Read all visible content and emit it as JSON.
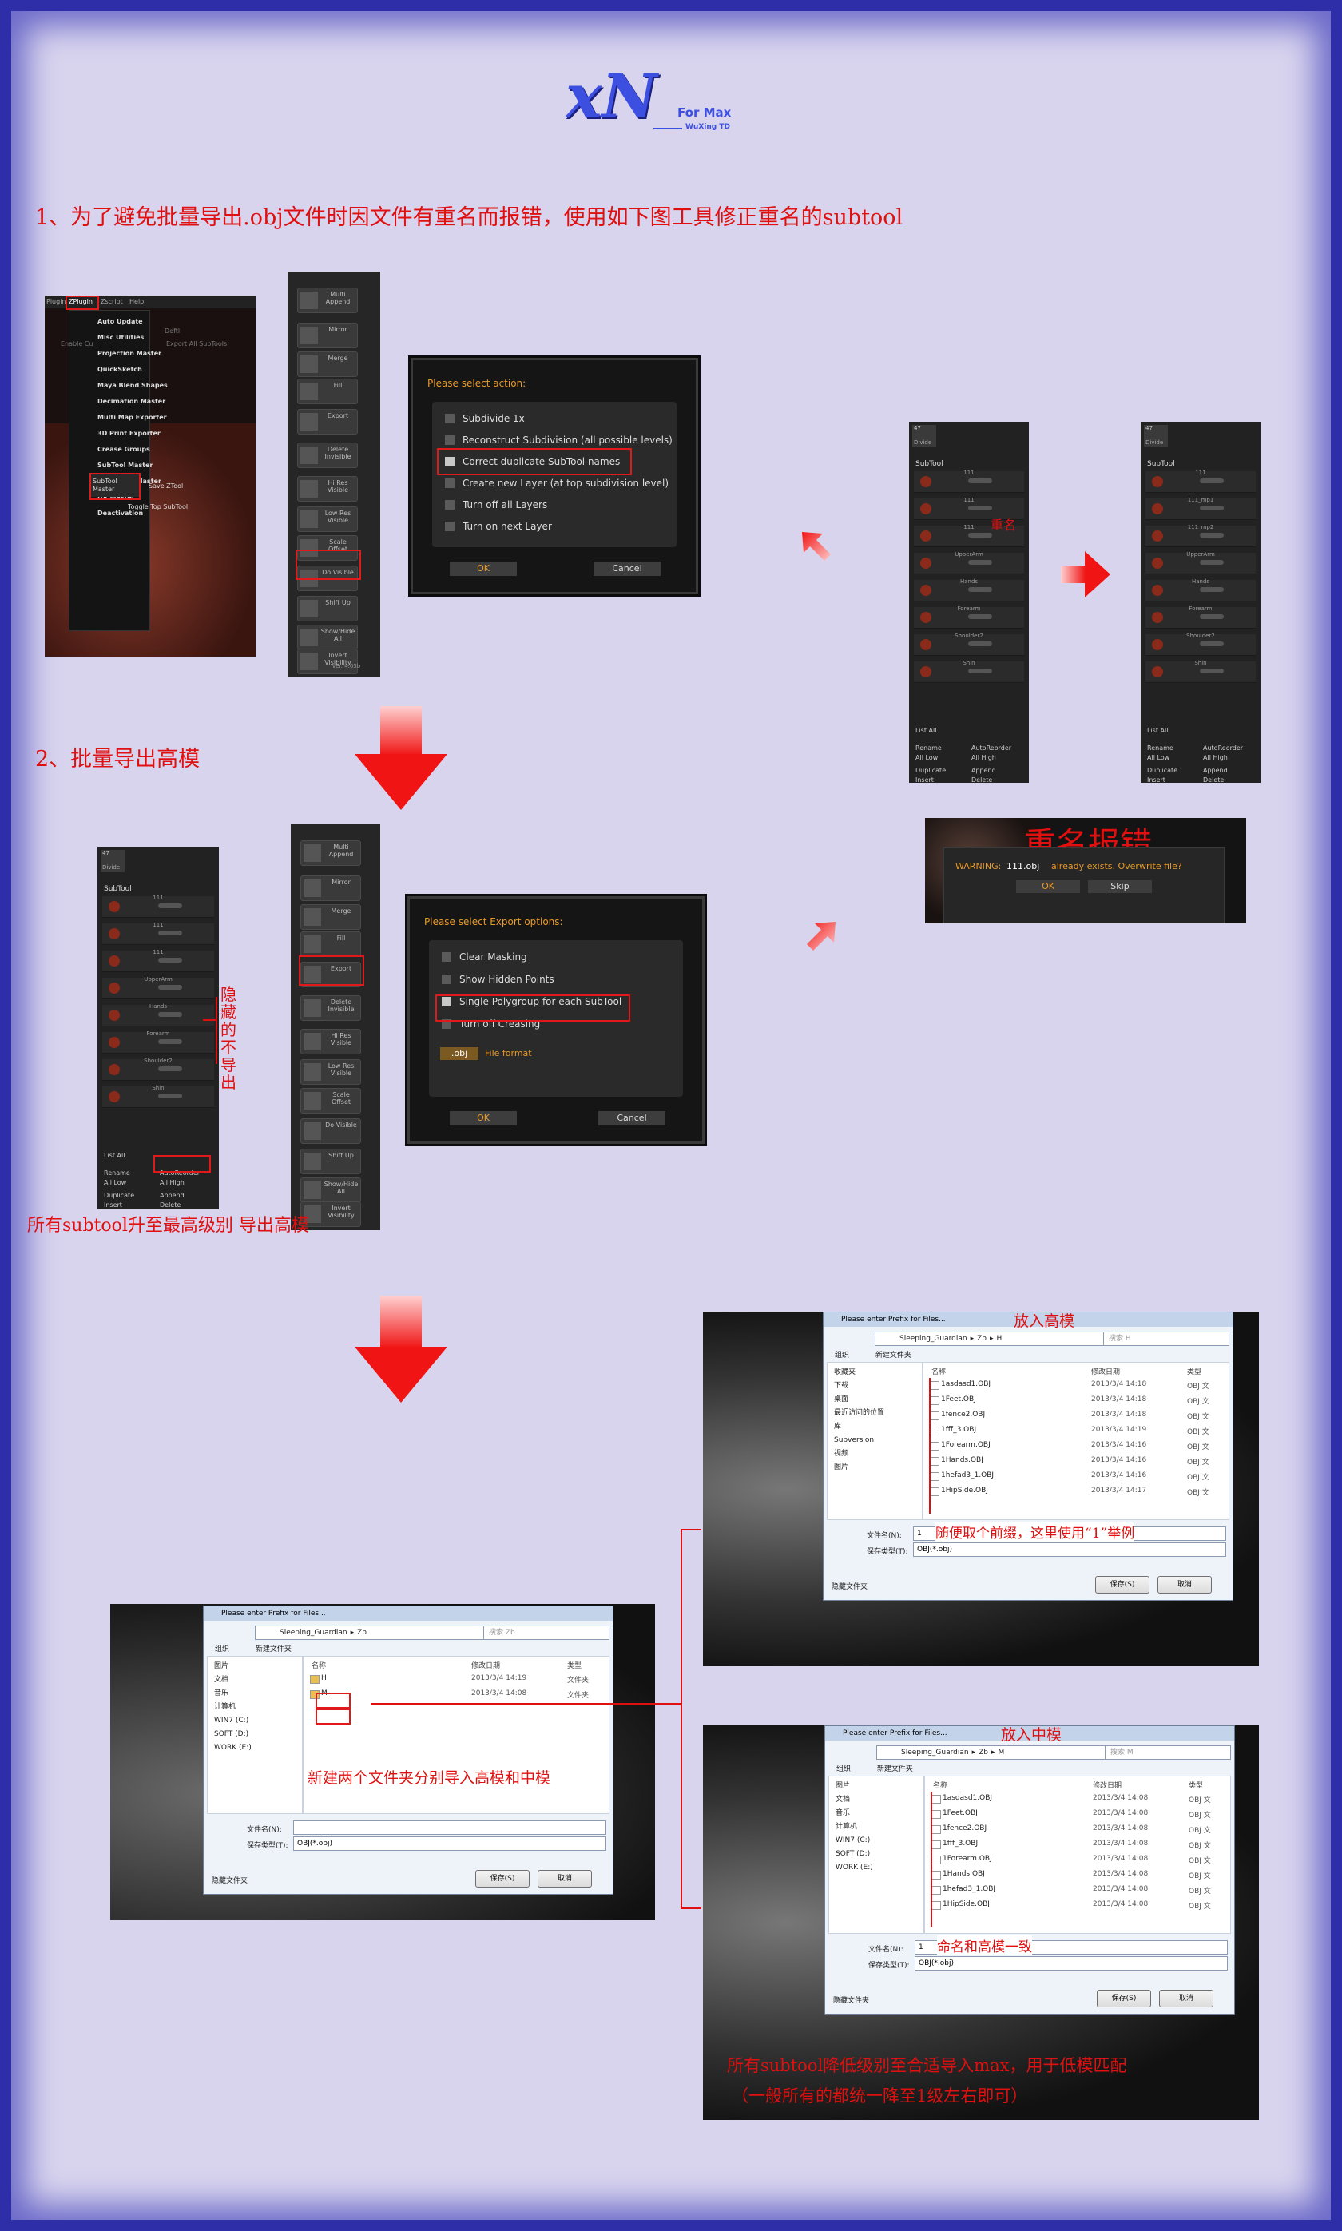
{
  "logo": {
    "main": "xN",
    "sub": "For Max",
    "author": "WuXing TD"
  },
  "section1": {
    "heading": "1、为了避免批量导出.obj文件时因文件有重名而报错，使用如下图工具修正重名的subtool"
  },
  "section2": {
    "heading": "2、批量导出高模",
    "note_upgrade": "所有subtool升至最高级别 导出高模"
  },
  "zplugin_menu": {
    "top_tabs": [
      "Plugin",
      "ZPlugin",
      "Zscript",
      "Help"
    ],
    "items": [
      "Auto Update",
      "Misc Utilities",
      "Projection Master",
      "QuickSketch",
      "Maya Blend Shapes",
      "Decimation Master",
      "Multi Map Exporter",
      "3D Print Exporter",
      "Crease Groups",
      "SubTool Master",
      "Transpose Master",
      "UV Master",
      "Deactivation"
    ],
    "side_labels": [
      "Deftl",
      "Export All SubTools",
      "Enable Cu"
    ],
    "subtool_master_btn": "SubTool Master",
    "save_ztool": "Save ZTool",
    "toggle_top": "Toggle Top SubTool"
  },
  "stm_panel": {
    "buttons": [
      "Multi Append",
      "Mirror",
      "Merge",
      "Fill",
      "Export",
      "Delete Invisible",
      "Hi Res Visible",
      "Low Res Visible",
      "Scale Offset",
      "Do Visible",
      "Shift Up",
      "Show/Hide All",
      "Invert Visibility"
    ],
    "footer": "ver. 4.03b"
  },
  "action_dialog": {
    "title": "Please select action:",
    "options": [
      {
        "label": "Subdivide 1x",
        "checked": false
      },
      {
        "label": "Reconstruct Subdivision (all possible levels)",
        "checked": false
      },
      {
        "label": "Correct duplicate SubTool names",
        "checked": true
      },
      {
        "label": "Create new Layer (at top subdivision level)",
        "checked": false
      },
      {
        "label": "Turn off all Layers",
        "checked": false
      },
      {
        "label": "Turn on next Layer",
        "checked": false
      }
    ],
    "ok": "OK",
    "cancel": "Cancel"
  },
  "export_dialog": {
    "title": "Please select Export options:",
    "options": [
      {
        "label": "Clear Masking",
        "checked": false
      },
      {
        "label": "Show Hidden Points",
        "checked": false
      },
      {
        "label": "Single Polygroup for each SubTool",
        "checked": true
      },
      {
        "label": "Turn off Creasing",
        "checked": false
      }
    ],
    "format": ".obj",
    "format_label": "File format",
    "ok": "OK",
    "cancel": "Cancel"
  },
  "subtool_panel": {
    "header": "SubTool",
    "layer_labels": [
      "111",
      "111",
      "111",
      "UpperArm",
      "Hands",
      "Forearm",
      "Shoulder2",
      "Shin"
    ],
    "layer_labels_fixed": [
      "111",
      "111_mp1",
      "111_mp2",
      "UpperArm",
      "Hands",
      "Forearm",
      "Shoulder2",
      "Shin"
    ],
    "list_all": "List All",
    "rename": "Rename",
    "autoreorder": "AutoReorder",
    "all_low": "All Low",
    "all_high": "All High",
    "duplicate": "Duplicate",
    "append": "Append",
    "insert": "Insert",
    "delete": "Delete",
    "top_label": "47",
    "top_sub": "Divide"
  },
  "dup_note": "重名",
  "hidden_note": "隐藏的不导出",
  "error_box": {
    "heading": "重名报错",
    "warning": "WARNING:",
    "file": "111.obj",
    "message": "already exists. Overwrite file?",
    "ok": "OK",
    "skip": "Skip"
  },
  "main_dialog": {
    "title": "Please enter Prefix for Files...",
    "path": [
      "Sleeping_Guardian",
      "Zb"
    ],
    "search": "搜索 Zb",
    "toolbar": [
      "组织",
      "新建文件夹"
    ],
    "nav": [
      "图片",
      "文档",
      "音乐",
      "计算机",
      "WIN7 (C:)",
      "SOFT (D:)",
      "WORK (E:)"
    ],
    "col_name": "名称",
    "col_date": "修改日期",
    "col_type": "类型",
    "files": [
      {
        "name": "H",
        "date": "2013/3/4 14:19",
        "type": "文件夹"
      },
      {
        "name": "M",
        "date": "2013/3/4 14:08",
        "type": "文件夹"
      }
    ],
    "filename_label": "文件名(N):",
    "filetype_label": "保存类型(T):",
    "filetype": "OBJ(*.obj)",
    "save": "保存(S)",
    "cancel": "取消",
    "hide": "隐藏文件夹",
    "note": "新建两个文件夹分别导入高模和中模"
  },
  "dialog_h": {
    "title": "Please enter Prefix for Files...",
    "path": [
      "Sleeping_Guardian",
      "Zb",
      "H"
    ],
    "search": "搜索 H",
    "toolbar": [
      "组织",
      "新建文件夹"
    ],
    "nav": [
      "收藏夹",
      "下载",
      "桌面",
      "最近访问的位置",
      "库",
      "Subversion",
      "视频",
      "图片"
    ],
    "files": [
      {
        "name": "1asdasd1.OBJ",
        "date": "2013/3/4 14:18",
        "type": "OBJ 文"
      },
      {
        "name": "1Feet.OBJ",
        "date": "2013/3/4 14:18",
        "type": "OBJ 文"
      },
      {
        "name": "1fence2.OBJ",
        "date": "2013/3/4 14:18",
        "type": "OBJ 文"
      },
      {
        "name": "1fff_3.OBJ",
        "date": "2013/3/4 14:19",
        "type": "OBJ 文"
      },
      {
        "name": "1Forearm.OBJ",
        "date": "2013/3/4 14:16",
        "type": "OBJ 文"
      },
      {
        "name": "1Hands.OBJ",
        "date": "2013/3/4 14:16",
        "type": "OBJ 文"
      },
      {
        "name": "1hefad3_1.OBJ",
        "date": "2013/3/4 14:16",
        "type": "OBJ 文"
      },
      {
        "name": "1HipSide.OBJ",
        "date": "2013/3/4 14:17",
        "type": "OBJ 文"
      }
    ],
    "filename": "1",
    "filetype": "OBJ(*.obj)",
    "heading": "放入高模",
    "note": "随便取个前缀，这里使用“1”举例",
    "save": "保存(S)",
    "cancel": "取消",
    "hide": "隐藏文件夹",
    "filename_label": "文件名(N):",
    "filetype_label": "保存类型(T):",
    "col_name": "名称",
    "col_date": "修改日期",
    "col_type": "类型"
  },
  "dialog_m": {
    "title": "Please enter Prefix for Files...",
    "path": [
      "Sleeping_Guardian",
      "Zb",
      "M"
    ],
    "search": "搜索 M",
    "toolbar": [
      "组织",
      "新建文件夹"
    ],
    "nav": [
      "图片",
      "文档",
      "音乐",
      "计算机",
      "WIN7 (C:)",
      "SOFT (D:)",
      "WORK (E:)"
    ],
    "files": [
      {
        "name": "1asdasd1.OBJ",
        "date": "2013/3/4 14:08",
        "type": "OBJ 文"
      },
      {
        "name": "1Feet.OBJ",
        "date": "2013/3/4 14:08",
        "type": "OBJ 文"
      },
      {
        "name": "1fence2.OBJ",
        "date": "2013/3/4 14:08",
        "type": "OBJ 文"
      },
      {
        "name": "1fff_3.OBJ",
        "date": "2013/3/4 14:08",
        "type": "OBJ 文"
      },
      {
        "name": "1Forearm.OBJ",
        "date": "2013/3/4 14:08",
        "type": "OBJ 文"
      },
      {
        "name": "1Hands.OBJ",
        "date": "2013/3/4 14:08",
        "type": "OBJ 文"
      },
      {
        "name": "1hefad3_1.OBJ",
        "date": "2013/3/4 14:08",
        "type": "OBJ 文"
      },
      {
        "name": "1HipSide.OBJ",
        "date": "2013/3/4 14:08",
        "type": "OBJ 文"
      }
    ],
    "filename": "1",
    "filetype": "OBJ(*.obj)",
    "heading": "放入中模",
    "note": "命名和高模一致",
    "save": "保存(S)",
    "cancel": "取消",
    "hide": "隐藏文件夹",
    "filename_label": "文件名(N):",
    "filetype_label": "保存类型(T):",
    "col_name": "名称",
    "col_date": "修改日期",
    "col_type": "类型"
  },
  "bottom_note": {
    "line1": "所有subtool降低级别至合适导入max，用于低模匹配",
    "line2": "（一般所有的都统一降至1级左右即可）"
  },
  "colors": {
    "accent": "#e01010",
    "frame": "#2e2fa8",
    "bg": "#d8d4ee",
    "zbrush_orange": "#e89a28"
  }
}
